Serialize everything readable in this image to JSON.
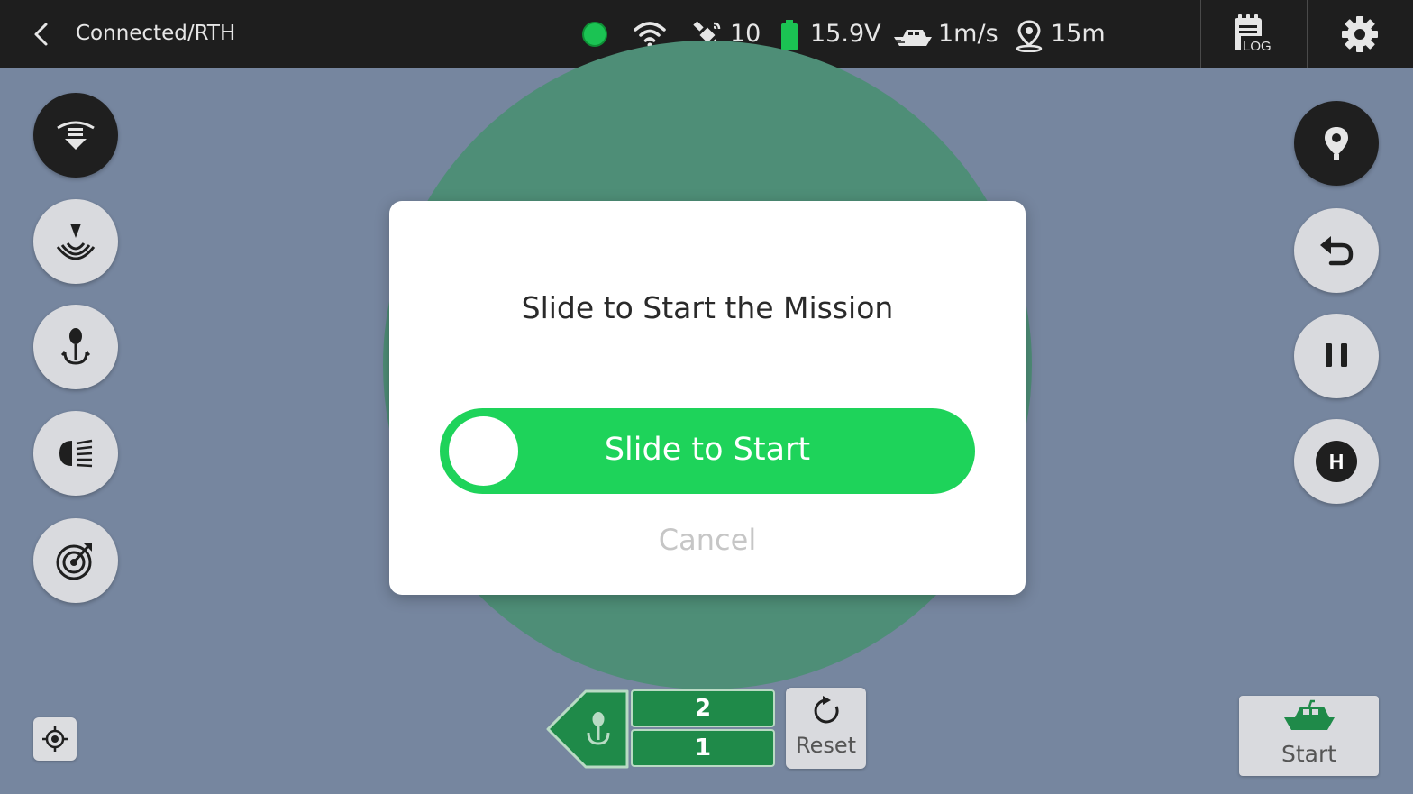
{
  "topbar": {
    "title": "Connected/RTH",
    "satellites": "10",
    "voltage": "15.9V",
    "speed": "1m/s",
    "distance": "15m",
    "log_label": "LOG",
    "status_color": "#1bc353",
    "battery_color": "#1bc353"
  },
  "left_tools": [
    {
      "icon": "drop-bait-icon",
      "active": true
    },
    {
      "icon": "sonar-icon",
      "active": false
    },
    {
      "icon": "fish-hook-icon",
      "active": false
    },
    {
      "icon": "headlight-icon",
      "active": false
    },
    {
      "icon": "radar-icon",
      "active": false
    }
  ],
  "right_tools": [
    {
      "icon": "waypoint-pin-icon",
      "active": true
    },
    {
      "icon": "return-icon",
      "active": false
    },
    {
      "icon": "pause-icon",
      "active": false
    },
    {
      "icon": "home-icon",
      "label": "H",
      "active": false
    }
  ],
  "waypoints": {
    "items": [
      "2",
      "1"
    ],
    "reset_label": "Reset"
  },
  "start": {
    "label": "Start"
  },
  "modal": {
    "title": "Slide to Start the Mission",
    "slider_label": "Slide to Start",
    "cancel_label": "Cancel",
    "accent": "#1ed35a"
  }
}
